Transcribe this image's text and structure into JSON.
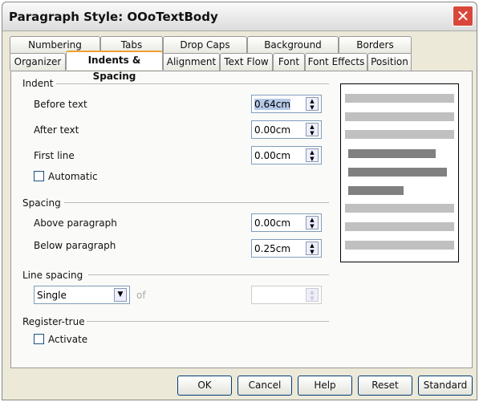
{
  "title": "Paragraph Style: OOoTextBody",
  "tabs_row1": [
    "Numbering",
    "Tabs",
    "Drop Caps",
    "Background",
    "Borders"
  ],
  "tabs_row2": [
    "Organizer",
    "Indents & Spacing",
    "Alignment",
    "Text Flow",
    "Font",
    "Font Effects",
    "Position"
  ],
  "active_tab": "Indents & Spacing",
  "indent": {
    "heading": "Indent",
    "before_label": "Before text",
    "before_value": "0.64cm",
    "after_label": "After text",
    "after_value": "0.00cm",
    "first_label": "First line",
    "first_value": "0.00cm",
    "automatic_label": "Automatic",
    "automatic_checked": false
  },
  "spacing": {
    "heading": "Spacing",
    "above_label": "Above paragraph",
    "above_value": "0.00cm",
    "below_label": "Below paragraph",
    "below_value": "0.25cm"
  },
  "line_spacing": {
    "heading": "Line spacing",
    "selected": "Single",
    "of_label": "of",
    "of_value": ""
  },
  "register": {
    "heading": "Register-true",
    "activate_label": "Activate",
    "activate_checked": false
  },
  "buttons": {
    "ok": "OK",
    "cancel": "Cancel",
    "help": "Help",
    "reset": "Reset",
    "standard": "Standard"
  }
}
